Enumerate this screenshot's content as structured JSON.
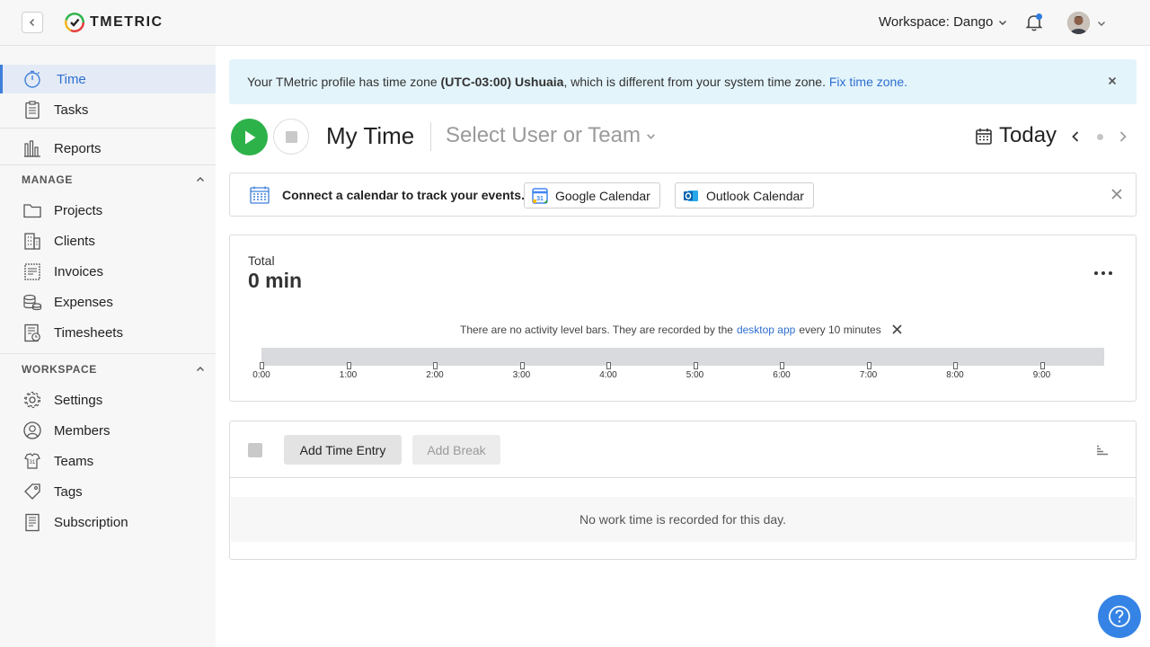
{
  "app": {
    "logo_text": "TMETRIC"
  },
  "header": {
    "workspace_label": "Workspace: Dango"
  },
  "sidebar": {
    "items": [
      {
        "label": "Time",
        "icon": "stopwatch-icon",
        "active": true
      },
      {
        "label": "Tasks",
        "icon": "clipboard-icon"
      },
      {
        "label": "Reports",
        "icon": "bar-chart-icon"
      }
    ],
    "manage": {
      "title": "MANAGE",
      "items": [
        {
          "label": "Projects",
          "icon": "folder-icon"
        },
        {
          "label": "Clients",
          "icon": "building-icon"
        },
        {
          "label": "Invoices",
          "icon": "invoice-icon"
        },
        {
          "label": "Expenses",
          "icon": "coins-icon"
        },
        {
          "label": "Timesheets",
          "icon": "timesheet-icon"
        }
      ]
    },
    "workspace": {
      "title": "WORKSPACE",
      "items": [
        {
          "label": "Settings",
          "icon": "gear-icon"
        },
        {
          "label": "Members",
          "icon": "user-icon"
        },
        {
          "label": "Teams",
          "icon": "team-icon"
        },
        {
          "label": "Tags",
          "icon": "tag-icon"
        },
        {
          "label": "Subscription",
          "icon": "receipt-icon"
        }
      ]
    }
  },
  "banner": {
    "prefix": "Your TMetric profile has time zone ",
    "timezone": "(UTC-03:00) Ushuaia",
    "suffix": ", which is different from your system time zone. ",
    "link": "Fix time zone."
  },
  "toolbar": {
    "title": "My Time",
    "user_select": "Select User or Team",
    "date_label": "Today"
  },
  "calendar_connect": {
    "text": "Connect a calendar to track your events.",
    "google_label": "Google Calendar",
    "outlook_label": "Outlook Calendar"
  },
  "summary": {
    "total_label": "Total",
    "total_value": "0 min",
    "activity_note_prefix": "There are no activity level bars. They are recorded by the",
    "activity_note_link": "desktop app",
    "activity_note_suffix": "every 10 minutes",
    "ticks": [
      "0:00",
      "1:00",
      "2:00",
      "3:00",
      "4:00",
      "5:00",
      "6:00",
      "7:00",
      "8:00",
      "9:00"
    ]
  },
  "entries": {
    "add_entry_label": "Add Time Entry",
    "add_break_label": "Add Break",
    "empty_text": "No work time is recorded for this day."
  },
  "colors": {
    "accent": "#3f7fd9",
    "play": "#2db24a",
    "banner_bg": "#e3f4fb",
    "help": "#3583e5"
  }
}
